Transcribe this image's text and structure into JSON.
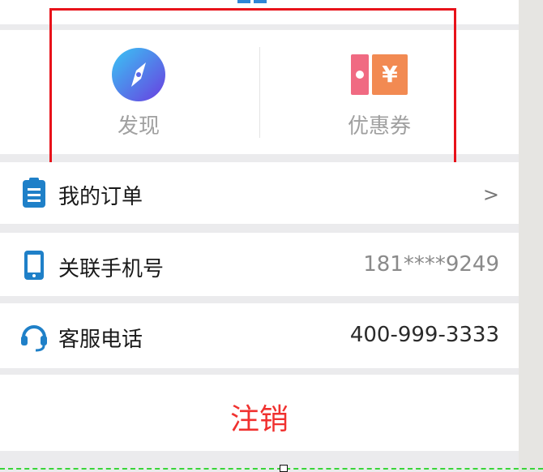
{
  "quick_actions": [
    {
      "label": "发现",
      "icon": "compass-icon"
    },
    {
      "label": "优惠券",
      "icon": "coupon-icon"
    }
  ],
  "menu": {
    "orders": {
      "label": "我的订单",
      "value": ">",
      "icon": "clipboard-icon"
    },
    "phone": {
      "label": "关联手机号",
      "value": "181****9249",
      "icon": "mobile-phone-icon"
    },
    "service": {
      "label": "客服电话",
      "value": "400-999-3333",
      "icon": "headset-icon"
    }
  },
  "logout": {
    "label": "注销"
  },
  "colors": {
    "accent_blue": "#2f86d6",
    "logout_red": "#f0312f",
    "highlight_red": "#e8121a",
    "coupon_pink": "#f06a82",
    "coupon_orange": "#f28a52"
  }
}
